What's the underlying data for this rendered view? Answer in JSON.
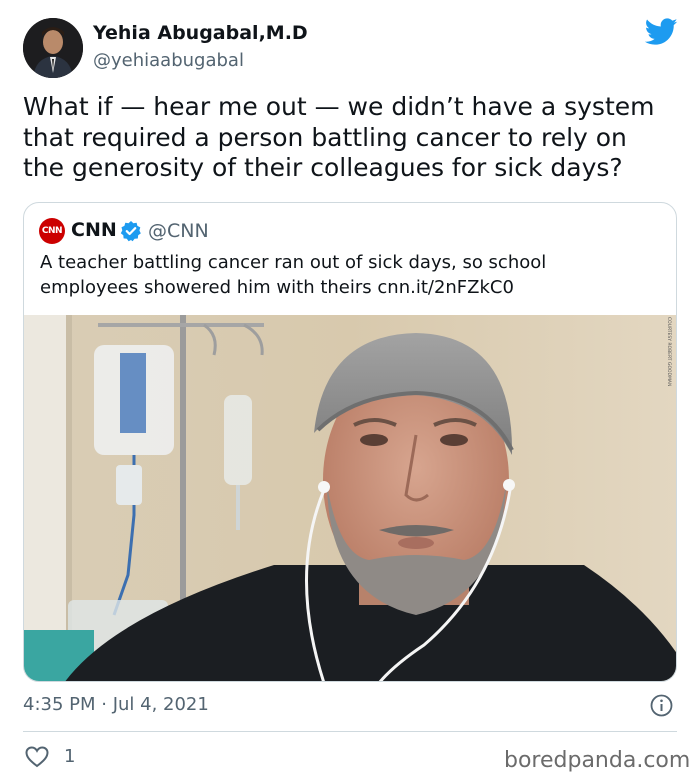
{
  "author": {
    "name": "Yehia Abugabal,M.D",
    "handle": "@yehiaabugabal"
  },
  "tweet": {
    "lines": [
      "What if — hear me out — we didn’t have a system",
      "that required a person battling cancer to rely on",
      "the generosity of their colleagues for sick days?"
    ],
    "timestamp": "4:35 PM · Jul 4, 2021",
    "like_count": "1"
  },
  "quoted_tweet": {
    "logo_text": "CNN",
    "name": "CNN",
    "handle": "@CNN",
    "lines": [
      "A teacher battling cancer ran out of sick days, so school",
      "employees showered him with theirs cnn.it/2nFZkC0"
    ],
    "photo_credit": "COURTESY ROBERT GOODMAN"
  },
  "watermark": "boredpanda.com",
  "icons": {
    "brand": "twitter-bird-icon",
    "verified": "verified-badge-icon",
    "info": "info-icon",
    "like": "heart-icon"
  },
  "colors": {
    "twitter_blue": "#1d9bf0",
    "cnn_red": "#cc0000",
    "muted_text": "#536471",
    "border": "#cfd9de"
  }
}
